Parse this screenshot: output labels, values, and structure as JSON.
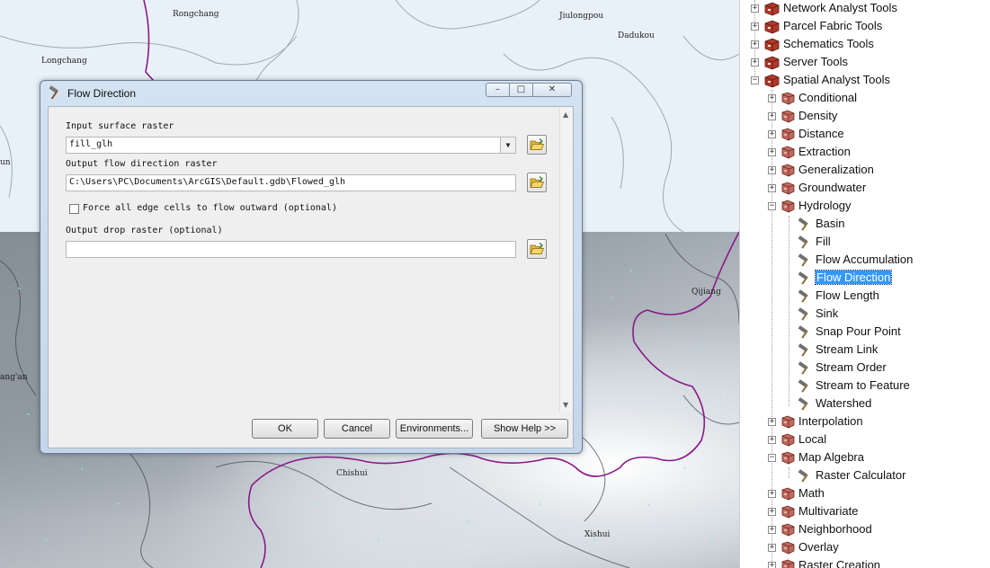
{
  "map": {
    "labels": {
      "rongchang": "Rongchang",
      "jiulongpou": "Jiulongpou",
      "dadukou": "Dadukou",
      "longchang": "Longchang",
      "un": "un",
      "qijiang": "Qijiang",
      "angan": "ang'an",
      "chishui": "Chishui",
      "xishui": "Xishui"
    }
  },
  "dialog": {
    "title": "Flow Direction",
    "input_surface_label": "Input surface raster",
    "input_surface_value": "fill_glh",
    "output_flow_label": "Output flow direction raster",
    "output_flow_value": "C:\\Users\\PC\\Documents\\ArcGIS\\Default.gdb\\Flowed_glh",
    "force_edge_label": "Force all edge cells to flow outward (optional)",
    "output_drop_label": "Output drop raster (optional)",
    "output_drop_value": "",
    "buttons": {
      "ok": "OK",
      "cancel": "Cancel",
      "environments": "Environments...",
      "show_help": "Show Help >>"
    }
  },
  "toolbox": {
    "top_items": [
      "Network Analyst Tools",
      "Parcel Fabric Tools",
      "Schematics Tools",
      "Server Tools",
      "Spatial Analyst Tools"
    ],
    "sa_items": {
      "conditional": "Conditional",
      "density": "Density",
      "distance": "Distance",
      "extraction": "Extraction",
      "generalization": "Generalization",
      "groundwater": "Groundwater",
      "hydrology": "Hydrology",
      "interpolation": "Interpolation",
      "local": "Local",
      "map_algebra": "Map Algebra",
      "math": "Math",
      "multivariate": "Multivariate",
      "neighborhood": "Neighborhood",
      "overlay": "Overlay",
      "raster_creation": "Raster Creation"
    },
    "hydrology_tools": [
      "Basin",
      "Fill",
      "Flow Accumulation",
      "Flow Direction",
      "Flow Length",
      "Sink",
      "Snap Pour Point",
      "Stream Link",
      "Stream Order",
      "Stream to Feature",
      "Watershed"
    ],
    "map_algebra_tools": [
      "Raster Calculator"
    ],
    "selected_tool": "Flow Direction",
    "colors": {
      "selection": "#3399ff",
      "toolbox_red": "#b0392b",
      "border_purple": "#8a1a8a"
    }
  }
}
